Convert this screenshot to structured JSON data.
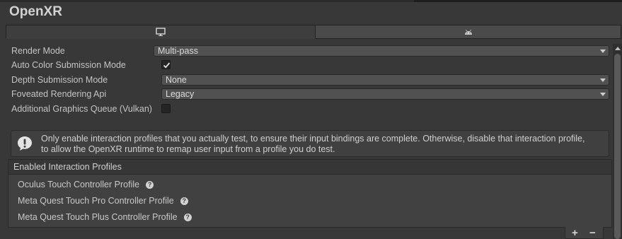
{
  "header": {
    "title": "OpenXR"
  },
  "platform_tabs": [
    {
      "icon": "monitor-icon"
    },
    {
      "icon": "android-icon"
    }
  ],
  "settings": {
    "render_mode": {
      "label": "Render Mode",
      "value": "Multi-pass"
    },
    "auto_color": {
      "label": "Auto Color Submission Mode",
      "checked": true
    },
    "depth_mode": {
      "label": "Depth Submission Mode",
      "value": "None"
    },
    "foveated_api": {
      "label": "Foveated Rendering Api",
      "value": "Legacy"
    },
    "additional_queue": {
      "label": "Additional Graphics Queue (Vulkan)",
      "checked": false
    }
  },
  "help": {
    "icon": "warning-icon",
    "text_line1": "Only enable interaction profiles that you actually test, to ensure their input bindings are complete. Otherwise, disable that interaction profile,",
    "text_line2": "to allow the OpenXR runtime to remap user input from a profile you do test."
  },
  "profiles": {
    "header": "Enabled Interaction Profiles",
    "items": [
      {
        "label": "Oculus Touch Controller Profile",
        "help": "?"
      },
      {
        "label": "Meta Quest Touch Pro Controller Profile",
        "help": "?"
      },
      {
        "label": "Meta Quest Touch Plus Controller Profile",
        "help": "?"
      }
    ],
    "add_label": "+",
    "remove_label": "−"
  }
}
